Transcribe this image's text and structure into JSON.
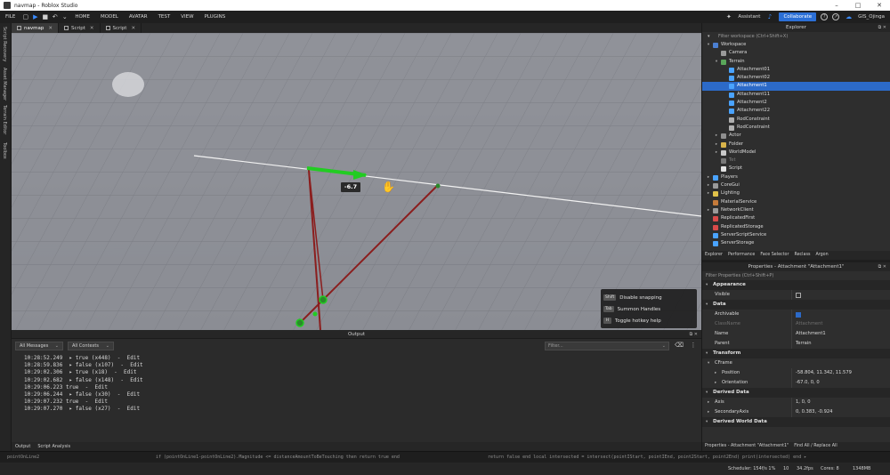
{
  "window": {
    "title": "navmap - Roblox Studio"
  },
  "menu": {
    "items": [
      "FILE",
      "HOME",
      "MODEL",
      "AVATAR",
      "TEST",
      "VIEW",
      "PLUGINS"
    ],
    "assistant": "Assistant",
    "collaborate": "Collaborate",
    "user": "GIS_Ojinga"
  },
  "left_rail": [
    "Script Recovery",
    "Asset Manager",
    "Terrain Editor",
    "Toolbox"
  ],
  "doc_tabs": [
    "navmap",
    "Script",
    "Script"
  ],
  "viewport": {
    "measure_value": "-6.7",
    "hotkeys": [
      {
        "key": "Shift",
        "label": "Disable snapping"
      },
      {
        "key": "Tab",
        "label": "Summon Handles"
      },
      {
        "key": "H",
        "label": "Toggle hotkey help"
      }
    ]
  },
  "output": {
    "title": "Output",
    "message_filter": "All Messages",
    "context_filter": "All Contexts",
    "filter_placeholder": "Filter...",
    "lines": [
      {
        "time": "10:28:52.249",
        "text": "  ▸ true (x448)  -  Edit"
      },
      {
        "time": "10:28:59.836",
        "text": "  ▸ false (x107)  -  Edit"
      },
      {
        "time": "10:29:02.306",
        "text": "  ▸ true (x18)  -  Edit"
      },
      {
        "time": "10:29:02.682",
        "text": "  ▸ false (x148)  -  Edit"
      },
      {
        "time": "10:29:06.223",
        "text": " true  -  Edit"
      },
      {
        "time": "10:29:06.244",
        "text": "  ▸ false (x30)  -  Edit"
      },
      {
        "time": "10:29:07.232",
        "text": " true  -  Edit"
      },
      {
        "time": "10:29:07.270",
        "text": "  ▸ false (x27)  -  Edit"
      }
    ],
    "tabs": [
      "Output",
      "Script Analysis"
    ]
  },
  "code_bar": {
    "left": "pointOnLine2",
    "mid": "if (pointOnLine1-pointOnLine2).Magnitude <= distanceAmountToBeTouching then return true end",
    "right": "return false end  local intersected = intersect(pointIStart, pointIEnd, point2Start, point2End)   print(intersected) end ▸"
  },
  "status_bar": {
    "scheduler": "Scheduler: 154f/s 1%",
    "zero": "10",
    "fps": "34.2fps",
    "cores": "Cores: 8",
    "memory": "1348MB"
  },
  "explorer": {
    "title": "Explorer",
    "filter_placeholder": "Filter workspace (Ctrl+Shift+X)",
    "items": [
      {
        "label": "Workspace",
        "depth": 0,
        "arrow": "▾",
        "icon": "#4b7fd1"
      },
      {
        "label": "Camera",
        "depth": 1,
        "arrow": "",
        "icon": "#9a9a9a"
      },
      {
        "label": "Terrain",
        "depth": 1,
        "arrow": "▾",
        "icon": "#5aa65a"
      },
      {
        "label": "Attachment01",
        "depth": 2,
        "arrow": "",
        "icon": "#4aa3ff"
      },
      {
        "label": "Attachment02",
        "depth": 2,
        "arrow": "",
        "icon": "#4aa3ff"
      },
      {
        "label": "Attachment1",
        "depth": 2,
        "arrow": "",
        "icon": "#4aa3ff",
        "selected": true
      },
      {
        "label": "Attachment11",
        "depth": 2,
        "arrow": "",
        "icon": "#4aa3ff"
      },
      {
        "label": "Attachment2",
        "depth": 2,
        "arrow": "",
        "icon": "#4aa3ff"
      },
      {
        "label": "Attachment22",
        "depth": 2,
        "arrow": "",
        "icon": "#4aa3ff"
      },
      {
        "label": "RodConstraint",
        "depth": 2,
        "arrow": "",
        "icon": "#b0b0b0"
      },
      {
        "label": "RodConstraint",
        "depth": 2,
        "arrow": "",
        "icon": "#b0b0b0"
      },
      {
        "label": "Actor",
        "depth": 1,
        "arrow": "▸",
        "icon": "#8f8f8f"
      },
      {
        "label": "Folder",
        "depth": 1,
        "arrow": "▸",
        "icon": "#d9b44a"
      },
      {
        "label": "WorldModel",
        "depth": 1,
        "arrow": "▸",
        "icon": "#c9c9c9"
      },
      {
        "label": "Tet",
        "depth": 1,
        "arrow": "",
        "icon": "#777777",
        "dim": true
      },
      {
        "label": "Script",
        "depth": 1,
        "arrow": "",
        "icon": "#e2e2e2"
      },
      {
        "label": "Players",
        "depth": 0,
        "arrow": "▸",
        "icon": "#4aa3ff"
      },
      {
        "label": "CoreGui",
        "depth": 0,
        "arrow": "▸",
        "icon": "#9a9a9a"
      },
      {
        "label": "Lighting",
        "depth": 0,
        "arrow": "▸",
        "icon": "#e0c24a"
      },
      {
        "label": "MaterialService",
        "depth": 0,
        "arrow": "",
        "icon": "#c47a3a"
      },
      {
        "label": "NetworkClient",
        "depth": 0,
        "arrow": "▸",
        "icon": "#9a9a9a"
      },
      {
        "label": "ReplicatedFirst",
        "depth": 0,
        "arrow": "",
        "icon": "#d94a4a"
      },
      {
        "label": "ReplicatedStorage",
        "depth": 0,
        "arrow": "",
        "icon": "#d94a4a"
      },
      {
        "label": "ServerScriptService",
        "depth": 0,
        "arrow": "",
        "icon": "#4aa3ff"
      },
      {
        "label": "ServerStorage",
        "depth": 0,
        "arrow": "",
        "icon": "#4aa3ff"
      }
    ],
    "tabs": [
      "Explorer",
      "Performance",
      "Face Selector",
      "Reclass",
      "Argon"
    ]
  },
  "properties": {
    "title": "Properties - Attachment \"Attachment1\"",
    "filter_placeholder": "Filter Properties (Ctrl+Shift+P)",
    "sections": {
      "appearance": "Appearance",
      "data": "Data",
      "transform": "Transform",
      "derived_data": "Derived Data",
      "derived_world_data": "Derived World Data"
    },
    "rows": {
      "visible": "Visible",
      "archivable": "Archivable",
      "classname": "ClassName",
      "classname_value": "Attachment",
      "name": "Name",
      "name_value": "Attachment1",
      "parent": "Parent",
      "parent_value": "Terrain",
      "cframe": "CFrame",
      "position": "Position",
      "position_value": "-58.804, 11.342, 11.579",
      "orientation": "Orientation",
      "orientation_value": "-67.0, 0, 0",
      "axis": "Axis",
      "axis_value": "1, 0, 0",
      "secondary_axis": "SecondaryAxis",
      "secondary_axis_value": "0, 0.383, -0.924"
    },
    "tabs": [
      "Properties - Attachment \"Attachment1\"",
      "Find All / Replace All"
    ]
  },
  "colors": {
    "selection": "#2c6ac8",
    "accent": "#2b6fd6",
    "handle": "#22cc22",
    "rod": "#8b1e1e"
  }
}
